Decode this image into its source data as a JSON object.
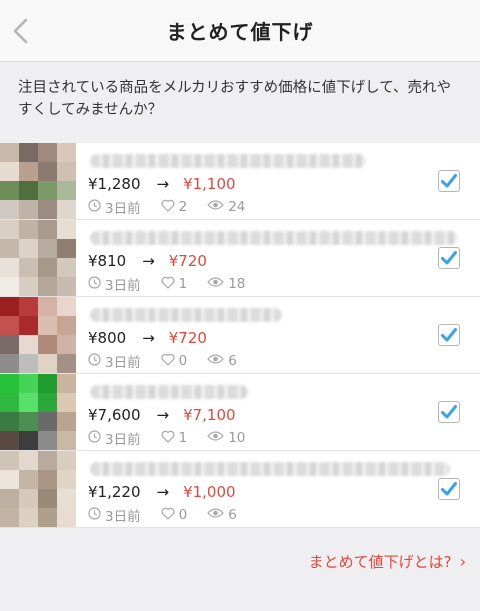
{
  "header": {
    "title": "まとめて値下げ"
  },
  "description": "注目されている商品をメルカリおすすめ価格に値下げして、売れやすくしてみませんか？",
  "items": [
    {
      "old_price": "¥1,280",
      "new_price": "¥1,100",
      "posted": "3日前",
      "likes": "2",
      "views": "24",
      "checked": true,
      "thumb_colors": [
        "#c9b9a8",
        "#7a6a64",
        "#a08a80",
        "#d8c8bb",
        "#e6dbd0",
        "#b7a08e",
        "#8c7a70",
        "#cfc0b2",
        "#6f8f5a",
        "#4f6f3f",
        "#7a9a68",
        "#a9b99a",
        "#cfc8c0",
        "#bfb2a6",
        "#9c8b80",
        "#e0d6cc"
      ],
      "title_width": 276
    },
    {
      "old_price": "¥810",
      "new_price": "¥720",
      "posted": "3日前",
      "likes": "1",
      "views": "18",
      "checked": true,
      "thumb_colors": [
        "#d9cfc3",
        "#bfb3a6",
        "#a89a8c",
        "#e6ddd3",
        "#c5b7aa",
        "#dcd2c7",
        "#b9ab9d",
        "#8f7f72",
        "#e8e1d9",
        "#cbbfb3",
        "#a9998a",
        "#d3c8bd",
        "#f0ebe5",
        "#d8cdc2",
        "#b6a899",
        "#c7bcb0"
      ],
      "title_width": 368
    },
    {
      "old_price": "¥800",
      "new_price": "¥720",
      "posted": "3日前",
      "likes": "0",
      "views": "6",
      "checked": true,
      "thumb_colors": [
        "#9c2020",
        "#b83a3a",
        "#d6b2a6",
        "#e8d6cc",
        "#c45050",
        "#a82a2a",
        "#d9bfb2",
        "#c9a494",
        "#7a6a6a",
        "#e6d9d0",
        "#b08a7a",
        "#d0b3a6",
        "#8c8c8c",
        "#bdbdbd",
        "#e2d2c6",
        "#a59088"
      ],
      "title_width": 192
    },
    {
      "old_price": "¥7,600",
      "new_price": "¥7,100",
      "posted": "3日前",
      "likes": "1",
      "views": "10",
      "checked": true,
      "thumb_colors": [
        "#27c23a",
        "#45d457",
        "#1f9e2f",
        "#c9b59f",
        "#2fb840",
        "#58e06a",
        "#2aa93a",
        "#dcc9b3",
        "#3c7a44",
        "#4d8f52",
        "#6a6a6a",
        "#b9a58f",
        "#5a4a40",
        "#3d3d3d",
        "#8a8a8a",
        "#cbb8a2"
      ],
      "title_width": 158
    },
    {
      "old_price": "¥1,220",
      "new_price": "¥1,000",
      "posted": "3日前",
      "likes": "0",
      "views": "6",
      "checked": true,
      "thumb_colors": [
        "#cfc4b8",
        "#e2d8cd",
        "#b9ab9c",
        "#d8cdbf",
        "#ece4da",
        "#c4b6a7",
        "#a99684",
        "#e0d4c6",
        "#bdb0a2",
        "#d6cabc",
        "#9a8a7a",
        "#e8dfd4",
        "#c2b3a3",
        "#ddd1c3",
        "#b19f8d",
        "#e6dccf"
      ],
      "title_width": 360
    }
  ],
  "footer": {
    "link_label": "まとめて値下げとは?",
    "chevron": "›"
  },
  "colors": {
    "accent": "#e0483c",
    "check": "#3aa3e8"
  }
}
